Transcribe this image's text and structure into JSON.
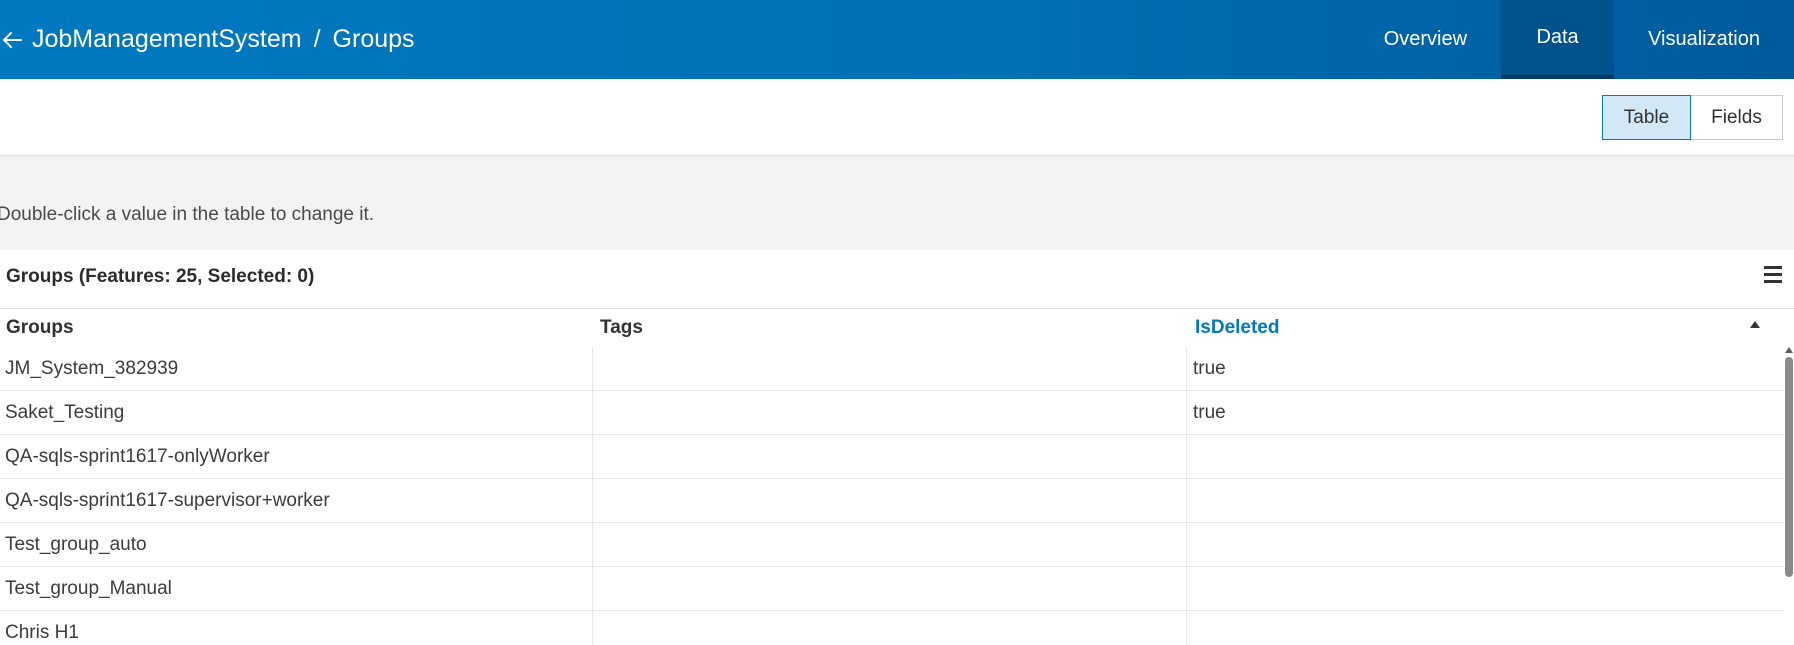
{
  "header": {
    "back_icon": "arrow-left-icon",
    "breadcrumb": {
      "app": "JobManagementSystem",
      "separator": "/",
      "current": "Groups"
    },
    "nav_tabs": [
      {
        "label": "Overview",
        "active": false
      },
      {
        "label": "Data",
        "active": true
      },
      {
        "label": "Visualization",
        "active": false
      }
    ]
  },
  "view_toggle": {
    "table_label": "Table",
    "fields_label": "Fields",
    "selected": "Table"
  },
  "hint": "Double-click a value in the table to change it.",
  "table": {
    "title": "Groups (Features: 25, Selected: 0)",
    "menu_icon": "hamburger-menu-icon",
    "columns": [
      {
        "label": "Groups"
      },
      {
        "label": "Tags"
      },
      {
        "label": "IsDeleted",
        "sorted": "ascending"
      }
    ],
    "rows": [
      {
        "groups": "JM_System_382939",
        "tags": "",
        "isdeleted": "true"
      },
      {
        "groups": "Saket_Testing",
        "tags": "",
        "isdeleted": "true"
      },
      {
        "groups": "QA-sqls-sprint1617-onlyWorker",
        "tags": "",
        "isdeleted": ""
      },
      {
        "groups": "QA-sqls-sprint1617-supervisor+worker",
        "tags": "",
        "isdeleted": ""
      },
      {
        "groups": "Test_group_auto",
        "tags": "",
        "isdeleted": ""
      },
      {
        "groups": "Test_group_Manual",
        "tags": "",
        "isdeleted": ""
      },
      {
        "groups": "Chris H1",
        "tags": "",
        "isdeleted": ""
      }
    ]
  },
  "colors": {
    "header_bg": "#0079c1",
    "active_tab_bg": "#00538a",
    "sorted_column": "#0079c1",
    "toggle_selected_bg": "#d2e8f7"
  }
}
